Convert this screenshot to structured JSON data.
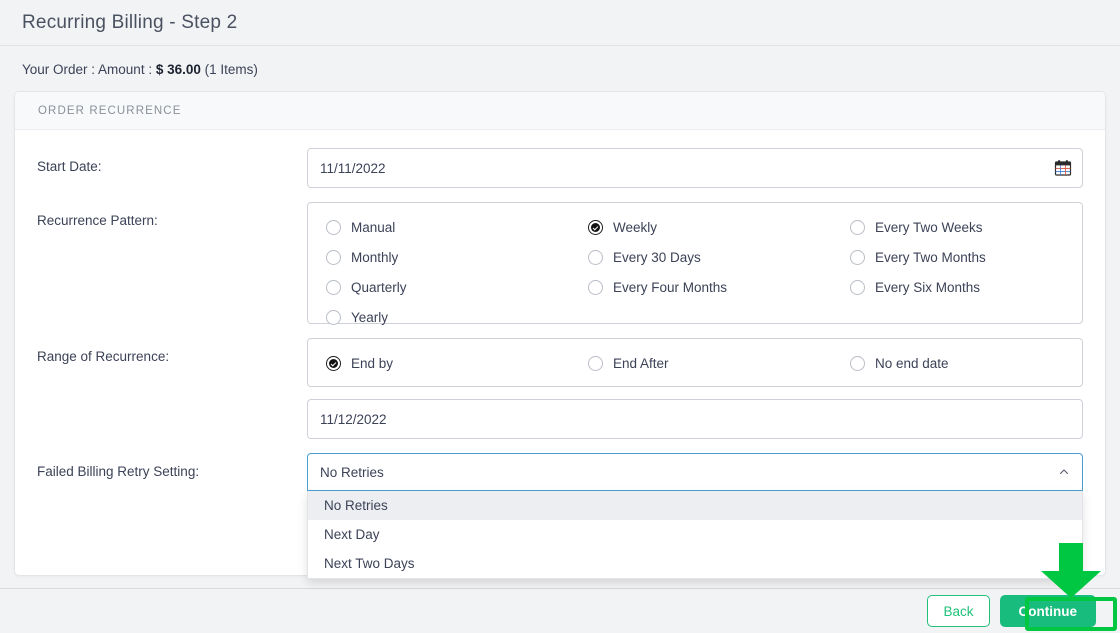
{
  "header": {
    "title": "Recurring Billing - Step 2"
  },
  "order_summary": {
    "prefix": "Your Order : Amount : ",
    "amount": "$ 36.00",
    "items": " (1 Items)"
  },
  "card": {
    "section_title": "ORDER RECURRENCE"
  },
  "start_date": {
    "label": "Start Date:",
    "value": "11/11/2022",
    "icon": "calendar-icon"
  },
  "recurrence_pattern": {
    "label": "Recurrence Pattern:",
    "options": [
      {
        "label": "Manual",
        "checked": false
      },
      {
        "label": "Weekly",
        "checked": true
      },
      {
        "label": "Every Two Weeks",
        "checked": false
      },
      {
        "label": "Monthly",
        "checked": false
      },
      {
        "label": "Every 30 Days",
        "checked": false
      },
      {
        "label": "Every Two Months",
        "checked": false
      },
      {
        "label": "Quarterly",
        "checked": false
      },
      {
        "label": "Every Four Months",
        "checked": false
      },
      {
        "label": "Every Six Months",
        "checked": false
      },
      {
        "label": "Yearly",
        "checked": false
      }
    ]
  },
  "range_of_recurrence": {
    "label": "Range of Recurrence:",
    "options": [
      {
        "label": "End by",
        "checked": true
      },
      {
        "label": "End After",
        "checked": false
      },
      {
        "label": "No end date",
        "checked": false
      }
    ],
    "end_date_value": "11/12/2022"
  },
  "failed_billing_retry": {
    "label": "Failed Billing Retry Setting:",
    "selected": "No Retries",
    "expanded": true,
    "chevron_icon": "chevron-up-icon",
    "options": [
      {
        "label": "No Retries",
        "highlighted": true
      },
      {
        "label": "Next Day",
        "highlighted": false
      },
      {
        "label": "Next Two Days",
        "highlighted": false
      }
    ]
  },
  "footer": {
    "back_label": "Back",
    "continue_label": "Continue"
  },
  "annotation": {
    "arrow_icon": "down-arrow-annotation",
    "target": "Continue",
    "color": "#00c742"
  },
  "colors": {
    "page_background": "#f2f3f5",
    "card_background": "#ffffff",
    "accent_green": "#18bd7d",
    "annotation_green": "#00c742",
    "focus_blue": "#4a9fd4",
    "text": "#3c4257"
  }
}
